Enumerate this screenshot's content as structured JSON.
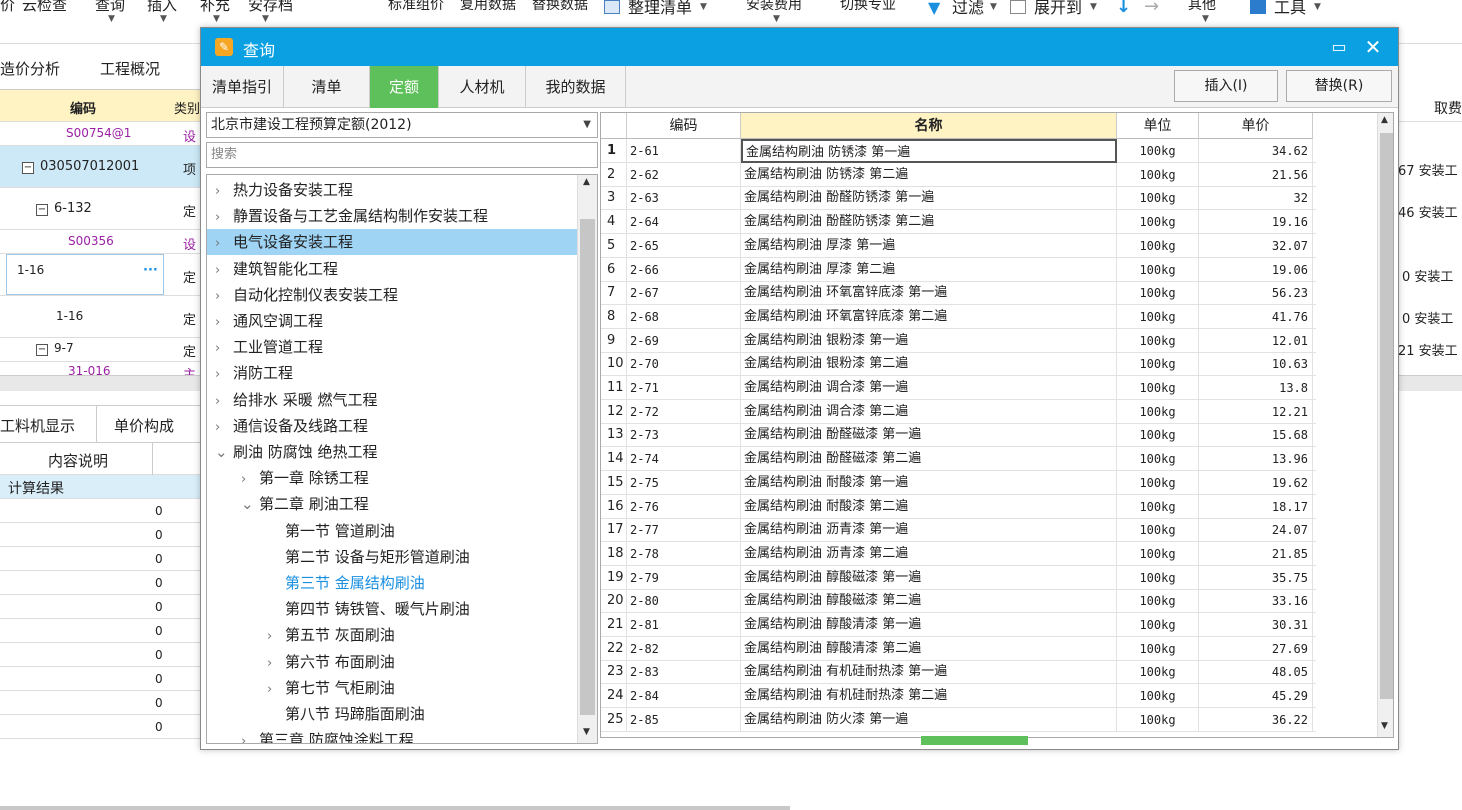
{
  "toolbar": {
    "items": [
      "价",
      "云检查",
      "查询",
      "插入",
      "补充",
      "安存档"
    ],
    "center_items": [
      "标准组价",
      "复用数据",
      "替换数据"
    ],
    "organize": "整理清单",
    "install_fee": "安装费用",
    "switch_major": "切换专业",
    "filter": "过滤",
    "expand_to": "展开到",
    "other": "其他",
    "tools": "工具"
  },
  "bg_tabs": [
    "造价分析",
    "工程概况"
  ],
  "bg_table": {
    "header_code": "编码",
    "header_type": "类别",
    "rows": [
      {
        "code": "S00754@1",
        "type": "设",
        "purple": true,
        "indent": 2
      },
      {
        "code": "030507012001",
        "type": "项",
        "purple": false,
        "indent": 0,
        "box": "−",
        "selected": true
      },
      {
        "code": "6-132",
        "type": "定",
        "purple": false,
        "indent": 1,
        "box": "−"
      },
      {
        "code": "S00356",
        "type": "设",
        "purple": true,
        "indent": 2
      },
      {
        "code": "1-16",
        "type": "定",
        "purple": false,
        "indent": 0,
        "editing": true
      },
      {
        "code": "1-16",
        "type": "定",
        "purple": false,
        "indent": 1
      },
      {
        "code": "9-7",
        "type": "定",
        "purple": false,
        "indent": 1,
        "box": "−"
      },
      {
        "code": "31-016",
        "type": "主",
        "purple": true,
        "indent": 2
      }
    ]
  },
  "bg_right": {
    "header": "取费",
    "cells": [
      "67 安装工",
      "46 安装工",
      "0 安装工",
      "0 安装工",
      "21 安装工"
    ]
  },
  "bg_tabs2": [
    "工料机显示",
    "单价构成"
  ],
  "bg_result": {
    "header": "内容说明",
    "subheader": "计算结果",
    "values": [
      "0",
      "0",
      "0",
      "0",
      "0",
      "0",
      "0",
      "0",
      "0",
      "0"
    ]
  },
  "dialog": {
    "title": "查询",
    "tabs": [
      "清单指引",
      "清单",
      "定额",
      "人材机",
      "我的数据"
    ],
    "active_tab": 2,
    "insert_button": "插入(I)",
    "replace_button": "替换(R)",
    "library": "北京市建设工程预算定额(2012)",
    "search_placeholder": "搜索",
    "tree": [
      {
        "label": "热力设备安装工程",
        "level": 0,
        "arrow": ">"
      },
      {
        "label": "静置设备与工艺金属结构制作安装工程",
        "level": 0,
        "arrow": ">"
      },
      {
        "label": "电气设备安装工程",
        "level": 0,
        "arrow": ">",
        "selected": true
      },
      {
        "label": "建筑智能化工程",
        "level": 0,
        "arrow": ">"
      },
      {
        "label": "自动化控制仪表安装工程",
        "level": 0,
        "arrow": ">"
      },
      {
        "label": "通风空调工程",
        "level": 0,
        "arrow": ">"
      },
      {
        "label": "工业管道工程",
        "level": 0,
        "arrow": ">"
      },
      {
        "label": "消防工程",
        "level": 0,
        "arrow": ">"
      },
      {
        "label": "给排水 采暖 燃气工程",
        "level": 0,
        "arrow": ">"
      },
      {
        "label": "通信设备及线路工程",
        "level": 0,
        "arrow": ">"
      },
      {
        "label": "刷油 防腐蚀 绝热工程",
        "level": 0,
        "arrow": "∨"
      },
      {
        "label": "第一章 除锈工程",
        "level": 1,
        "arrow": ">"
      },
      {
        "label": "第二章 刷油工程",
        "level": 1,
        "arrow": "∨"
      },
      {
        "label": "第一节 管道刷油",
        "level": 2,
        "arrow": ""
      },
      {
        "label": "第二节 设备与矩形管道刷油",
        "level": 2,
        "arrow": ""
      },
      {
        "label": "第三节 金属结构刷油",
        "level": 2,
        "arrow": "",
        "current": true
      },
      {
        "label": "第四节 铸铁管、暖气片刷油",
        "level": 2,
        "arrow": ""
      },
      {
        "label": "第五节 灰面刷油",
        "level": 2,
        "arrow": ">"
      },
      {
        "label": "第六节 布面刷油",
        "level": 2,
        "arrow": ">"
      },
      {
        "label": "第七节 气柜刷油",
        "level": 2,
        "arrow": ">"
      },
      {
        "label": "第八节 玛蹄脂面刷油",
        "level": 2,
        "arrow": ""
      },
      {
        "label": "第三章 防腐蚀涂料工程",
        "level": 1,
        "arrow": ">"
      }
    ],
    "grid": {
      "headers": {
        "code": "编码",
        "name": "名称",
        "unit": "单位",
        "price": "单价"
      },
      "rows": [
        {
          "n": "1",
          "code": "2-61",
          "name": "金属结构刷油 防锈漆 第一遍",
          "unit": "100kg",
          "price": "34.62"
        },
        {
          "n": "2",
          "code": "2-62",
          "name": "金属结构刷油 防锈漆 第二遍",
          "unit": "100kg",
          "price": "21.56"
        },
        {
          "n": "3",
          "code": "2-63",
          "name": "金属结构刷油 酚醛防锈漆 第一遍",
          "unit": "100kg",
          "price": "32"
        },
        {
          "n": "4",
          "code": "2-64",
          "name": "金属结构刷油 酚醛防锈漆 第二遍",
          "unit": "100kg",
          "price": "19.16"
        },
        {
          "n": "5",
          "code": "2-65",
          "name": "金属结构刷油 厚漆 第一遍",
          "unit": "100kg",
          "price": "32.07"
        },
        {
          "n": "6",
          "code": "2-66",
          "name": "金属结构刷油 厚漆 第二遍",
          "unit": "100kg",
          "price": "19.06"
        },
        {
          "n": "7",
          "code": "2-67",
          "name": "金属结构刷油 环氧富锌底漆 第一遍",
          "unit": "100kg",
          "price": "56.23"
        },
        {
          "n": "8",
          "code": "2-68",
          "name": "金属结构刷油 环氧富锌底漆 第二遍",
          "unit": "100kg",
          "price": "41.76"
        },
        {
          "n": "9",
          "code": "2-69",
          "name": "金属结构刷油 银粉漆 第一遍",
          "unit": "100kg",
          "price": "12.01"
        },
        {
          "n": "10",
          "code": "2-70",
          "name": "金属结构刷油 银粉漆 第二遍",
          "unit": "100kg",
          "price": "10.63"
        },
        {
          "n": "11",
          "code": "2-71",
          "name": "金属结构刷油 调合漆 第一遍",
          "unit": "100kg",
          "price": "13.8"
        },
        {
          "n": "12",
          "code": "2-72",
          "name": "金属结构刷油 调合漆 第二遍",
          "unit": "100kg",
          "price": "12.21"
        },
        {
          "n": "13",
          "code": "2-73",
          "name": "金属结构刷油 酚醛磁漆 第一遍",
          "unit": "100kg",
          "price": "15.68"
        },
        {
          "n": "14",
          "code": "2-74",
          "name": "金属结构刷油 酚醛磁漆 第二遍",
          "unit": "100kg",
          "price": "13.96"
        },
        {
          "n": "15",
          "code": "2-75",
          "name": "金属结构刷油 耐酸漆 第一遍",
          "unit": "100kg",
          "price": "19.62"
        },
        {
          "n": "16",
          "code": "2-76",
          "name": "金属结构刷油 耐酸漆 第二遍",
          "unit": "100kg",
          "price": "18.17"
        },
        {
          "n": "17",
          "code": "2-77",
          "name": "金属结构刷油 沥青漆 第一遍",
          "unit": "100kg",
          "price": "24.07"
        },
        {
          "n": "18",
          "code": "2-78",
          "name": "金属结构刷油 沥青漆 第二遍",
          "unit": "100kg",
          "price": "21.85"
        },
        {
          "n": "19",
          "code": "2-79",
          "name": "金属结构刷油 醇酸磁漆 第一遍",
          "unit": "100kg",
          "price": "35.75"
        },
        {
          "n": "20",
          "code": "2-80",
          "name": "金属结构刷油 醇酸磁漆 第二遍",
          "unit": "100kg",
          "price": "33.16"
        },
        {
          "n": "21",
          "code": "2-81",
          "name": "金属结构刷油 醇酸清漆 第一遍",
          "unit": "100kg",
          "price": "30.31"
        },
        {
          "n": "22",
          "code": "2-82",
          "name": "金属结构刷油 醇酸清漆 第二遍",
          "unit": "100kg",
          "price": "27.69"
        },
        {
          "n": "23",
          "code": "2-83",
          "name": "金属结构刷油 有机硅耐热漆 第一遍",
          "unit": "100kg",
          "price": "48.05"
        },
        {
          "n": "24",
          "code": "2-84",
          "name": "金属结构刷油 有机硅耐热漆 第二遍",
          "unit": "100kg",
          "price": "45.29"
        },
        {
          "n": "25",
          "code": "2-85",
          "name": "金属结构刷油 防火漆 第一遍",
          "unit": "100kg",
          "price": "36.22"
        }
      ]
    }
  },
  "colors": {
    "title_bar": "#0aa0e2",
    "active_tab": "#5ec05a",
    "selected_tree": "#9fd4f5",
    "header_highlight": "#fff3c4"
  }
}
